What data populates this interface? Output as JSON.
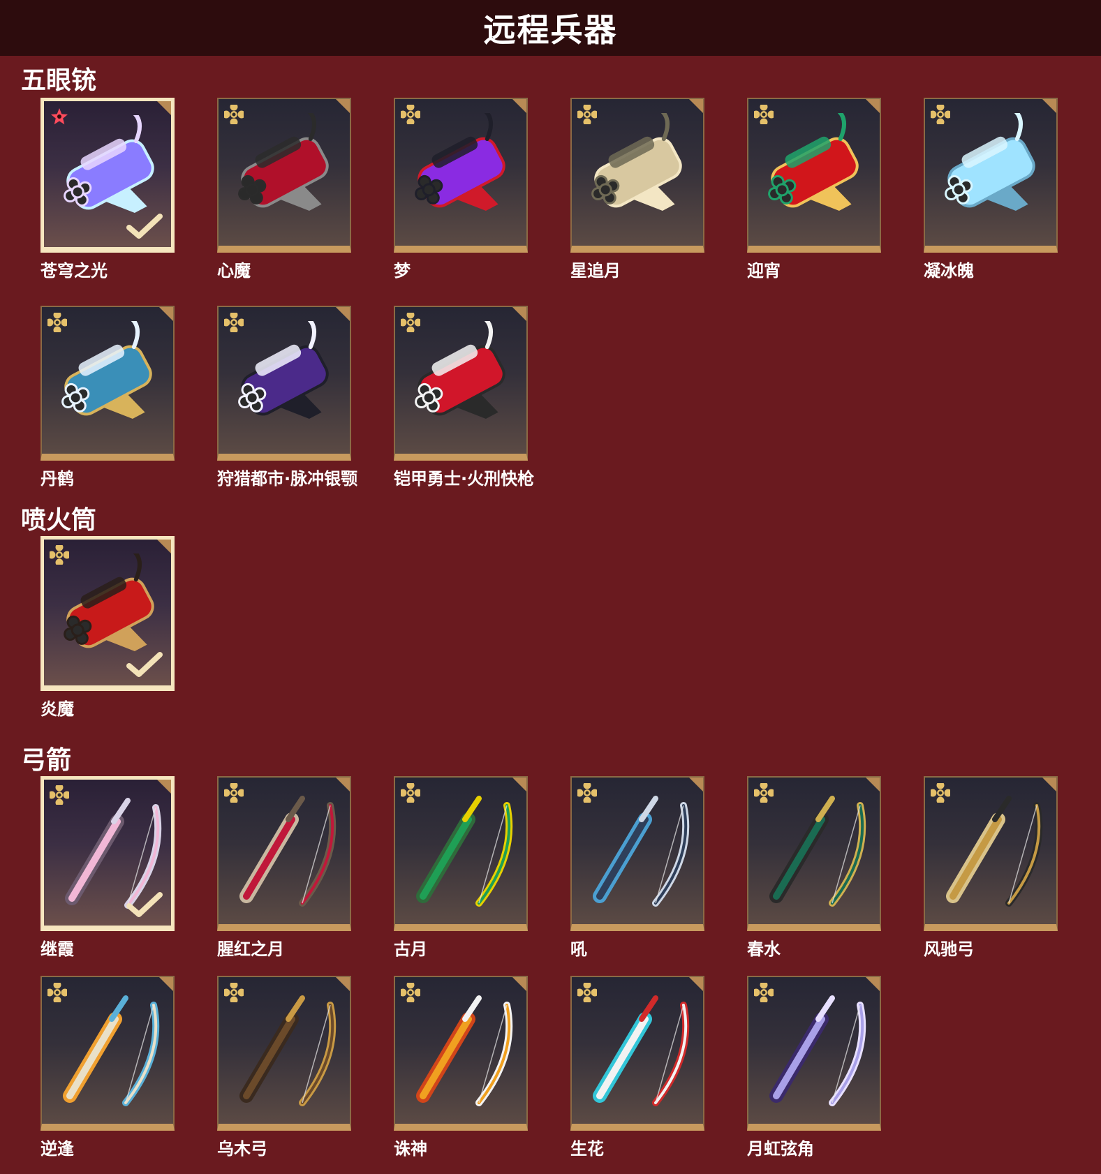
{
  "header": {
    "title": "远程兵器"
  },
  "sections": [
    {
      "title": "五眼铳",
      "items": [
        {
          "name": "苍穹之光",
          "selected": true,
          "rarity": "star-icon",
          "colors": [
            "#8a7cff",
            "#e7d6ff",
            "#c7f0ff"
          ]
        },
        {
          "name": "心魔",
          "selected": false,
          "rarity": "flower-icon",
          "colors": [
            "#b0102a",
            "#2b2b2b",
            "#8a8a8a"
          ]
        },
        {
          "name": "梦",
          "selected": false,
          "rarity": "flower-icon",
          "colors": [
            "#8a2be2",
            "#1f1f2a",
            "#d01a2a"
          ]
        },
        {
          "name": "星追月",
          "selected": false,
          "rarity": "flower-icon",
          "colors": [
            "#d8c8a0",
            "#6f6a55",
            "#f3e6c4"
          ]
        },
        {
          "name": "迎宵",
          "selected": false,
          "rarity": "flower-icon",
          "colors": [
            "#d1161b",
            "#1fa36b",
            "#f0c35a"
          ]
        },
        {
          "name": "凝冰魄",
          "selected": false,
          "rarity": "flower-icon",
          "colors": [
            "#9fe3ff",
            "#d9f6ff",
            "#6aa9c8"
          ]
        },
        {
          "name": "丹鹤",
          "selected": false,
          "rarity": "flower-icon",
          "colors": [
            "#3a8fb8",
            "#e7f3ff",
            "#d8b35b"
          ]
        },
        {
          "name": "狩猎都市·脉冲银颚",
          "selected": false,
          "rarity": "flower-icon",
          "colors": [
            "#4b2a8a",
            "#f2f2ff",
            "#1f1f2a"
          ]
        },
        {
          "name": "铠甲勇士·火刑快枪",
          "selected": false,
          "rarity": "flower-icon",
          "colors": [
            "#d1162a",
            "#f3f3f3",
            "#2a2a2a"
          ]
        }
      ]
    },
    {
      "title": "喷火筒",
      "items": [
        {
          "name": "炎魔",
          "selected": true,
          "rarity": "flower-icon",
          "colors": [
            "#c81a1a",
            "#2a1f1a",
            "#d0a15a"
          ]
        }
      ]
    },
    {
      "title": "弓箭",
      "items": [
        {
          "name": "继霞",
          "selected": true,
          "rarity": "flower-icon",
          "colors": [
            "#f1b7d6",
            "#d9d3e7",
            "#6c5a6e"
          ]
        },
        {
          "name": "腥红之月",
          "selected": false,
          "rarity": "flower-icon",
          "colors": [
            "#c0183a",
            "#6b5a4a",
            "#c9b8a0"
          ]
        },
        {
          "name": "古月",
          "selected": false,
          "rarity": "flower-icon",
          "colors": [
            "#1f9f55",
            "#e7d000",
            "#2f6b3b"
          ]
        },
        {
          "name": "吼",
          "selected": false,
          "rarity": "flower-icon",
          "colors": [
            "#2f3f5a",
            "#cfd8e6",
            "#4b9fd1"
          ]
        },
        {
          "name": "春水",
          "selected": false,
          "rarity": "flower-icon",
          "colors": [
            "#1a6b52",
            "#d0b050",
            "#2a2a2a"
          ]
        },
        {
          "name": "风驰弓",
          "selected": false,
          "rarity": "flower-icon",
          "colors": [
            "#c59a44",
            "#2a2a2a",
            "#d9c38a"
          ]
        },
        {
          "name": "逆逢",
          "selected": false,
          "rarity": "flower-icon",
          "colors": [
            "#e9e0c8",
            "#5ab0d8",
            "#f0a030"
          ]
        },
        {
          "name": "乌木弓",
          "selected": false,
          "rarity": "flower-icon",
          "colors": [
            "#6b4a2a",
            "#c99a44",
            "#3a2a1f"
          ]
        },
        {
          "name": "诛神",
          "selected": false,
          "rarity": "flower-icon",
          "colors": [
            "#f0a020",
            "#f3f3f3",
            "#d1451a"
          ]
        },
        {
          "name": "生花",
          "selected": false,
          "rarity": "flower-icon",
          "colors": [
            "#f2f2f2",
            "#d12a2a",
            "#33c6d8"
          ]
        },
        {
          "name": "月虹弦角",
          "selected": false,
          "rarity": "flower-icon",
          "colors": [
            "#a9a0e8",
            "#e8e0ff",
            "#3b2a6a"
          ]
        }
      ]
    }
  ]
}
